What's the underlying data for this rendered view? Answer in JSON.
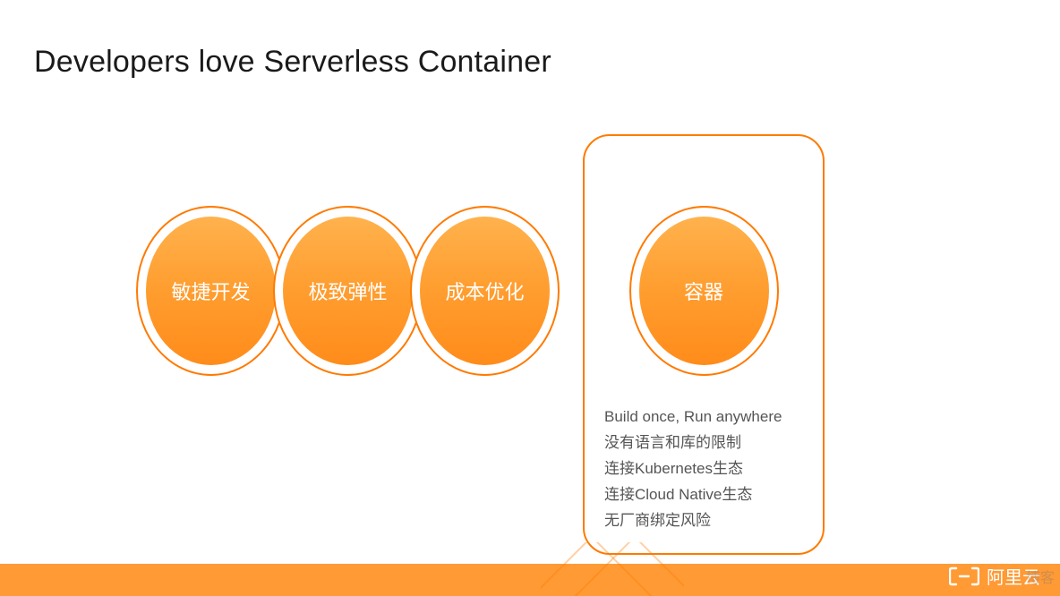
{
  "title": "Developers love Serverless Container",
  "circles": [
    {
      "label": "敏捷开发"
    },
    {
      "label": "极致弹性"
    },
    {
      "label": "成本优化"
    }
  ],
  "box": {
    "circle_label": "容器",
    "bullets": [
      "Build once, Run anywhere",
      "没有语言和库的限制",
      "连接Kubernetes生态",
      "连接Cloud Native生态",
      "无厂商绑定风险"
    ]
  },
  "brand": {
    "text": "阿里云"
  },
  "watermark": "博客",
  "colors": {
    "accent": "#FF7A00",
    "ball_top": "#FFB24D",
    "ball_bottom": "#FF8C1A",
    "footer": "#FF9A34"
  }
}
